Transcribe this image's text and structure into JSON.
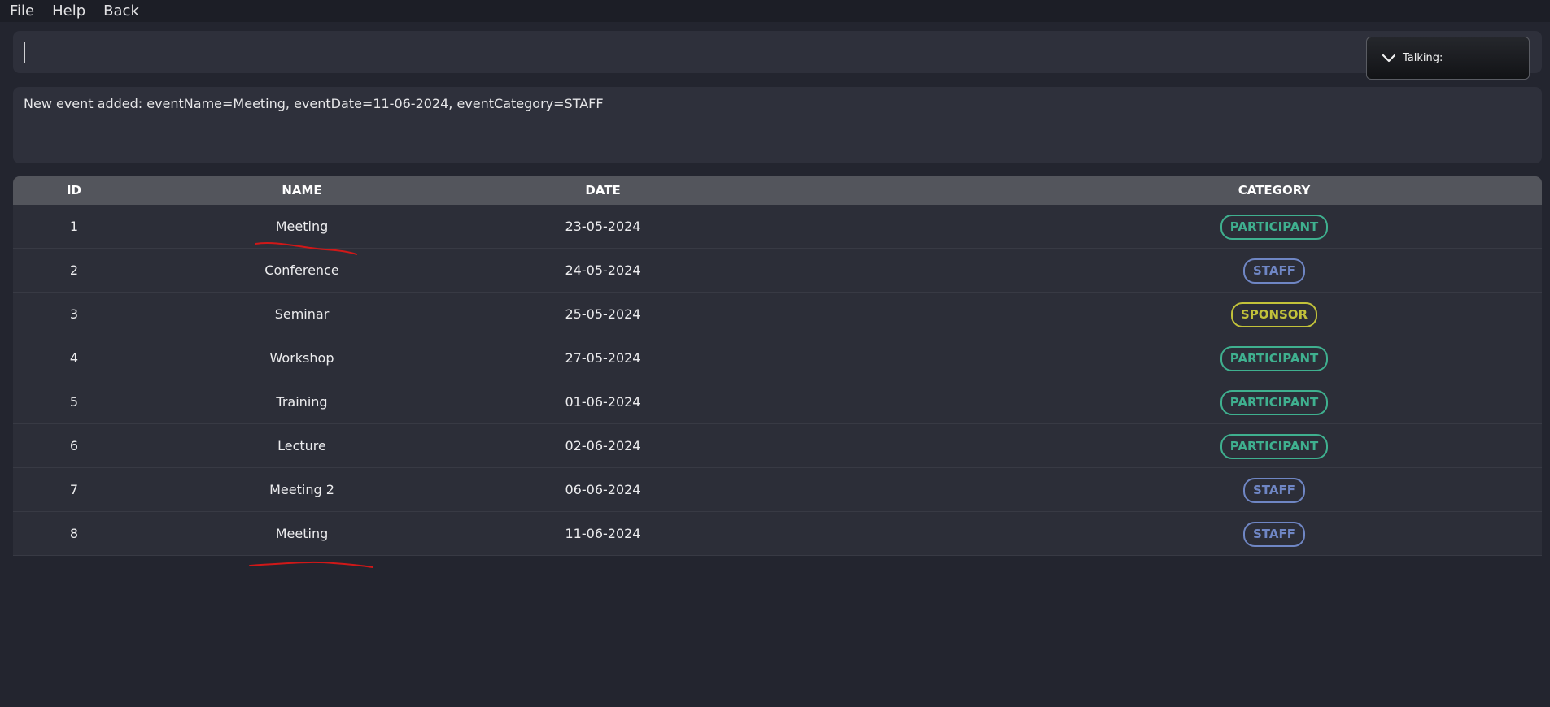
{
  "menu": {
    "file": "File",
    "help": "Help",
    "back": "Back"
  },
  "command": {
    "value": "",
    "placeholder": ""
  },
  "talking": {
    "label": "Talking:"
  },
  "result": {
    "message": "New event added: eventName=Meeting, eventDate=11-06-2024, eventCategory=STAFF"
  },
  "table": {
    "headers": {
      "id": "ID",
      "name": "NAME",
      "date": "DATE",
      "category": "CATEGORY"
    },
    "rows": [
      {
        "id": "1",
        "name": "Meeting",
        "date": "23-05-2024",
        "category": "PARTICIPANT"
      },
      {
        "id": "2",
        "name": "Conference",
        "date": "24-05-2024",
        "category": "STAFF"
      },
      {
        "id": "3",
        "name": "Seminar",
        "date": "25-05-2024",
        "category": "SPONSOR"
      },
      {
        "id": "4",
        "name": "Workshop",
        "date": "27-05-2024",
        "category": "PARTICIPANT"
      },
      {
        "id": "5",
        "name": "Training",
        "date": "01-06-2024",
        "category": "PARTICIPANT"
      },
      {
        "id": "6",
        "name": "Lecture",
        "date": "02-06-2024",
        "category": "PARTICIPANT"
      },
      {
        "id": "7",
        "name": "Meeting 2",
        "date": "06-06-2024",
        "category": "STAFF"
      },
      {
        "id": "8",
        "name": "Meeting",
        "date": "11-06-2024",
        "category": "STAFF"
      }
    ]
  },
  "colors": {
    "participant": "#3fb08f",
    "staff": "#6f86c4",
    "sponsor": "#c2c23a",
    "annotation": "#d01818"
  },
  "icons": {
    "talking_toggle": "chevron-down-icon"
  }
}
